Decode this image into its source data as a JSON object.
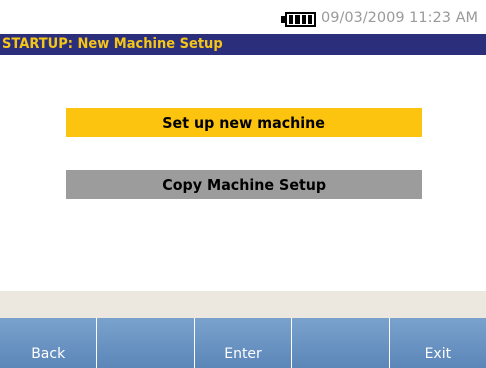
{
  "status": {
    "battery_icon": "battery-full-icon",
    "datetime": "09/03/2009 11:23 AM"
  },
  "header": {
    "title": "STARTUP: New Machine Setup"
  },
  "menu": {
    "items": [
      {
        "label": "Set up new machine",
        "selected": true
      },
      {
        "label": "Copy Machine Setup",
        "selected": false
      }
    ]
  },
  "softkeys": [
    {
      "label": "Back"
    },
    {
      "label": ""
    },
    {
      "label": "Enter"
    },
    {
      "label": ""
    },
    {
      "label": "Exit"
    }
  ],
  "colors": {
    "title_bar": "#2b2f7b",
    "title_text": "#f5c518",
    "selected_item": "#fcc40f",
    "unselected_item": "#9c9c9c",
    "softkey_bar": "#6b95c4",
    "datetime_text": "#9a9a9a"
  }
}
